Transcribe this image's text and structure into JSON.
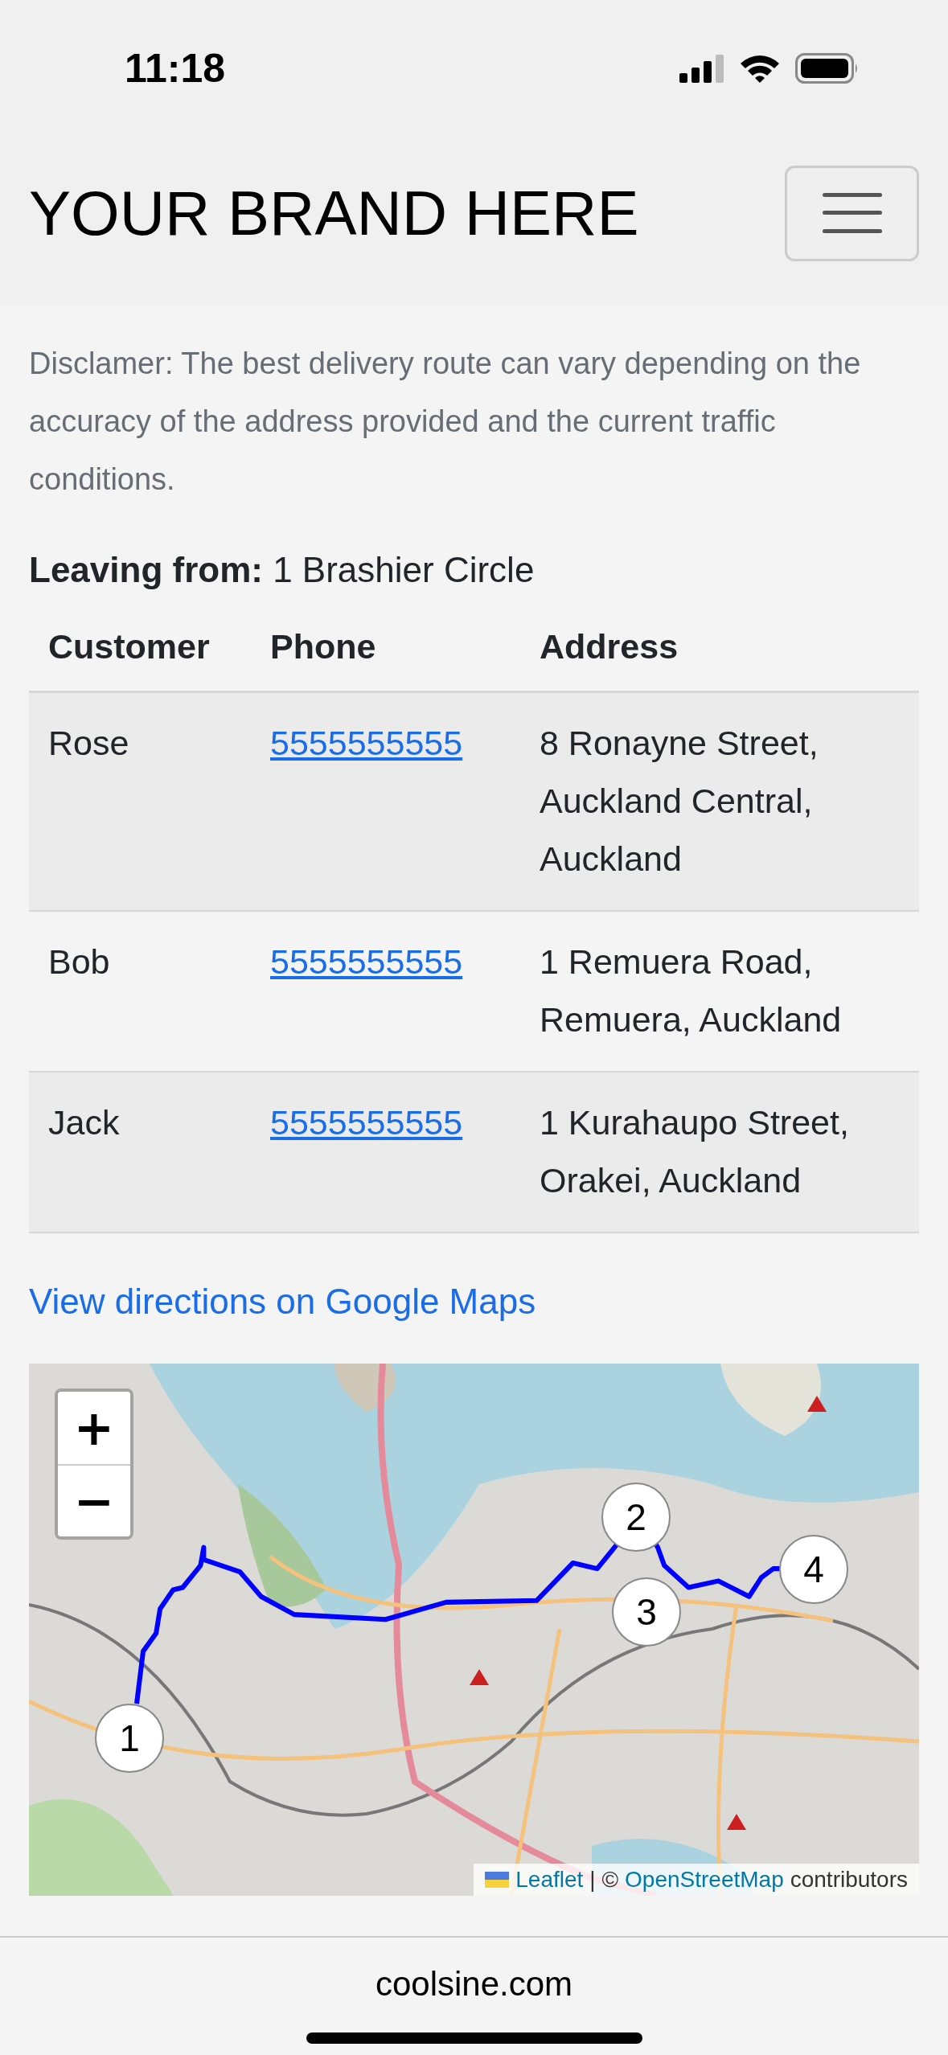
{
  "status_bar": {
    "time": "11:18"
  },
  "navbar": {
    "brand": "YOUR BRAND HERE"
  },
  "disclaimer": "Disclamer: The best delivery route can vary depending on the accuracy of the address provided and the current traffic conditions.",
  "leaving_from": "**Leaving from:** 1 Brashier Circle",
  "table": {
    "columns": [
      "Customer",
      "Phone",
      "Address"
    ],
    "rows": [
      {
        "customer": "Rose",
        "phone": "5555555555",
        "address": "8 Ronayne Street, Auckland Central, Auckland"
      },
      {
        "customer": "Bob",
        "phone": "5555555555",
        "address": "1 Remuera Road, Remuera, Auckland"
      },
      {
        "customer": "Jack",
        "phone": "5555555555",
        "address": "1 Kurahaupo Street, Orakei, Auckland"
      }
    ]
  },
  "directions_link": "View directions on Google Maps",
  "map": {
    "zoom_in": "+",
    "zoom_out": "−",
    "markers": [
      "1",
      "2",
      "3",
      "4"
    ],
    "attribution": {
      "leaflet": "Leaflet",
      "separator": "| ©",
      "osm": "OpenStreetMap",
      "suffix": "contributors"
    }
  },
  "footer": {
    "url": "coolsine.com"
  }
}
